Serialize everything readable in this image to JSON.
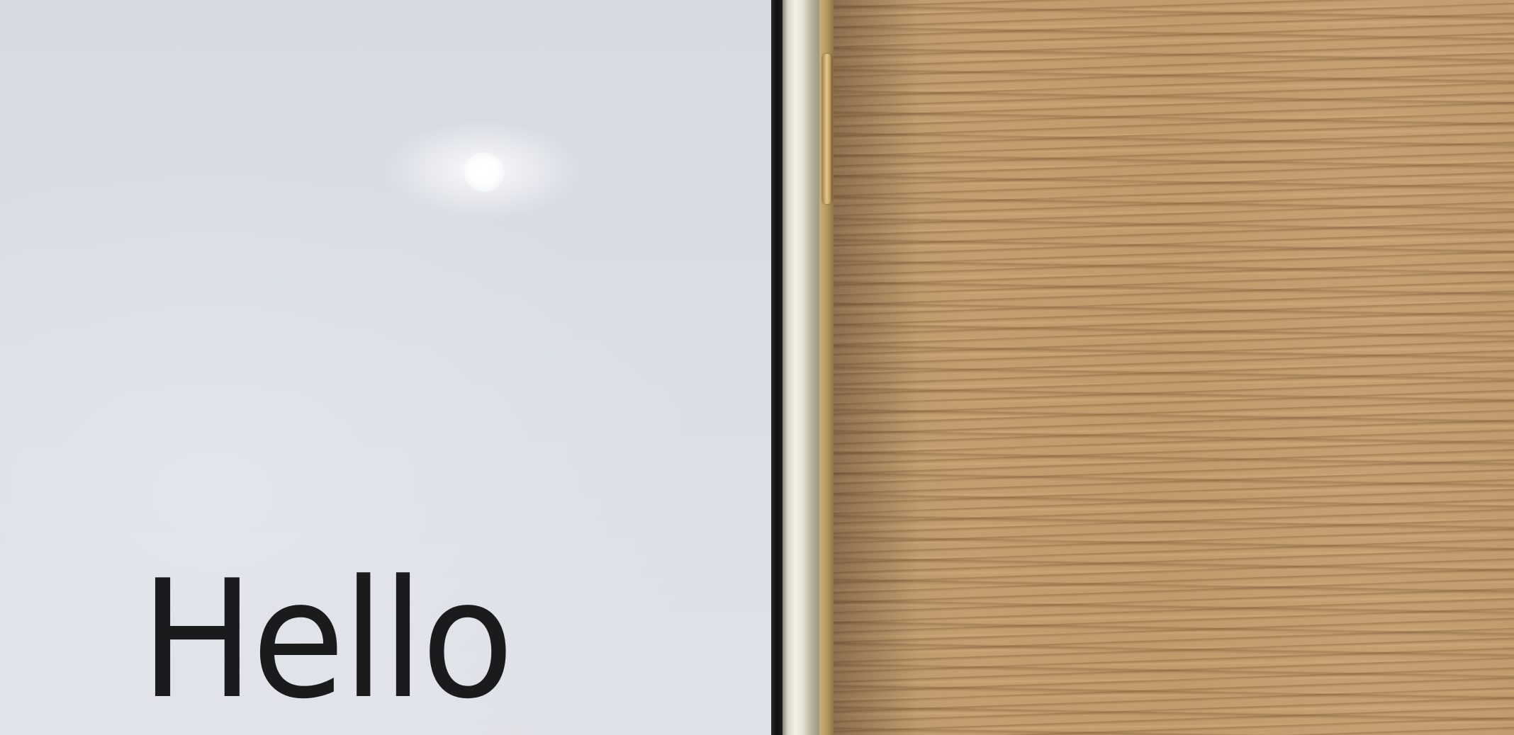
{
  "screen": {
    "greeting": "Hello"
  },
  "colors": {
    "screen_background": "#d9dde4",
    "text": "#1b1b1d",
    "frame_silver": "#e4e0d3",
    "button_gold": "#e6c68d",
    "wood": "#c29b6d"
  }
}
